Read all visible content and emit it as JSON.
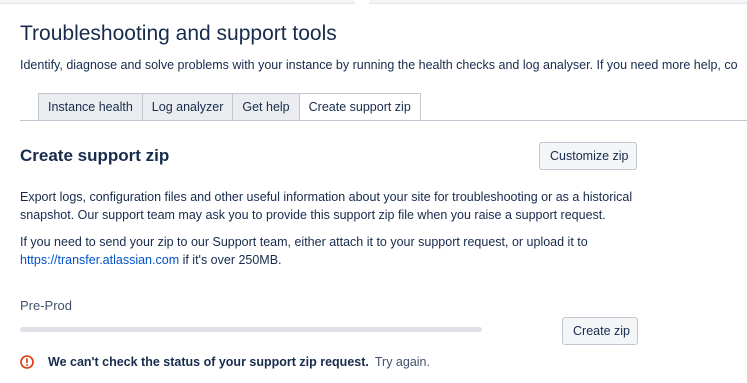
{
  "header": {
    "title": "Troubleshooting and support tools",
    "subtitle": "Identify, diagnose and solve problems with your instance by running the health checks and log analyser. If you need more help, co"
  },
  "tabs": [
    {
      "label": "Instance health"
    },
    {
      "label": "Log analyzer"
    },
    {
      "label": "Get help"
    },
    {
      "label": "Create support zip",
      "active": true
    }
  ],
  "section": {
    "title": "Create support zip",
    "customize_button": "Customize zip",
    "paragraph1": "Export logs, configuration files and other useful information about your site for troubleshooting or as a historical snapshot. Our support team may ask you to provide this support zip file when you raise a support request.",
    "paragraph2_before": "If you need to send your zip to our Support team, either attach it to your support request, or upload it to ",
    "paragraph2_link": "https://transfer.atlassian.com",
    "paragraph2_after": " if it's over 250MB."
  },
  "instance": {
    "name": "Pre-Prod",
    "create_button": "Create zip",
    "progress": 0
  },
  "error": {
    "icon": "error-circle-icon",
    "message": "We can't check the status of your support zip request.",
    "retry_label": "Try again.",
    "color": "#de350b"
  }
}
